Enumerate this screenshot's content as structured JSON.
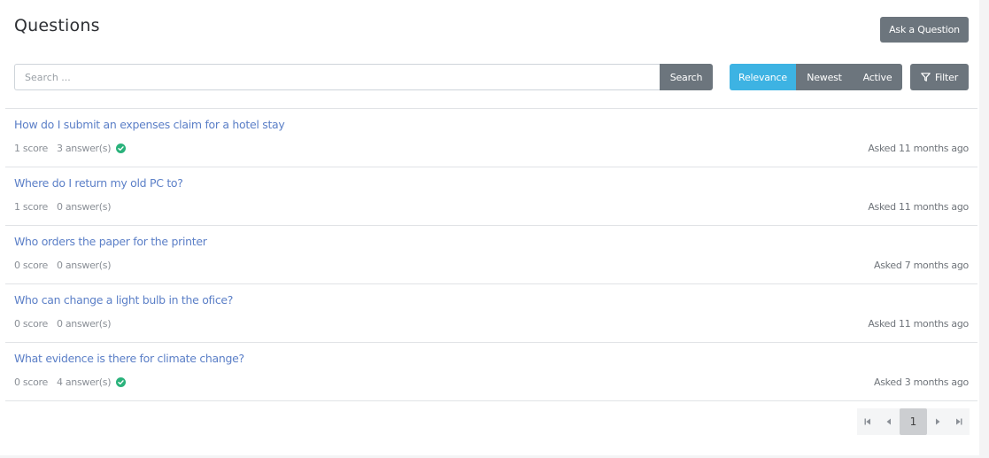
{
  "header": {
    "title": "Questions",
    "ask_button": "Ask a Question"
  },
  "search": {
    "placeholder": "Search ...",
    "value": "",
    "button": "Search"
  },
  "sort": {
    "options": [
      "Relevance",
      "Newest",
      "Active"
    ],
    "selected": "Relevance"
  },
  "filter": {
    "label": "Filter",
    "icon": "funnel-icon"
  },
  "colors": {
    "accent": "#3db3e3",
    "button": "#6c757d",
    "link": "#5b7fc7",
    "accepted": "#2ab27b"
  },
  "questions": [
    {
      "title": "How do I submit an expenses claim for a hotel stay",
      "score": "1 score",
      "answers": "3 answer(s)",
      "accepted": true,
      "asked": "Asked 11 months ago"
    },
    {
      "title": "Where do I return my old PC to?",
      "score": "1 score",
      "answers": "0 answer(s)",
      "accepted": false,
      "asked": "Asked 11 months ago"
    },
    {
      "title": "Who orders the paper for the printer",
      "score": "0 score",
      "answers": "0 answer(s)",
      "accepted": false,
      "asked": "Asked 7 months ago"
    },
    {
      "title": "Who can change a light bulb in the ofice?",
      "score": "0 score",
      "answers": "0 answer(s)",
      "accepted": false,
      "asked": "Asked 11 months ago"
    },
    {
      "title": "What evidence is there for climate change?",
      "score": "0 score",
      "answers": "4 answer(s)",
      "accepted": true,
      "asked": "Asked 3 months ago"
    }
  ],
  "pagination": {
    "current_page": "1",
    "controls": [
      "first-page-icon",
      "previous-page-icon",
      "next-page-icon",
      "last-page-icon"
    ]
  }
}
